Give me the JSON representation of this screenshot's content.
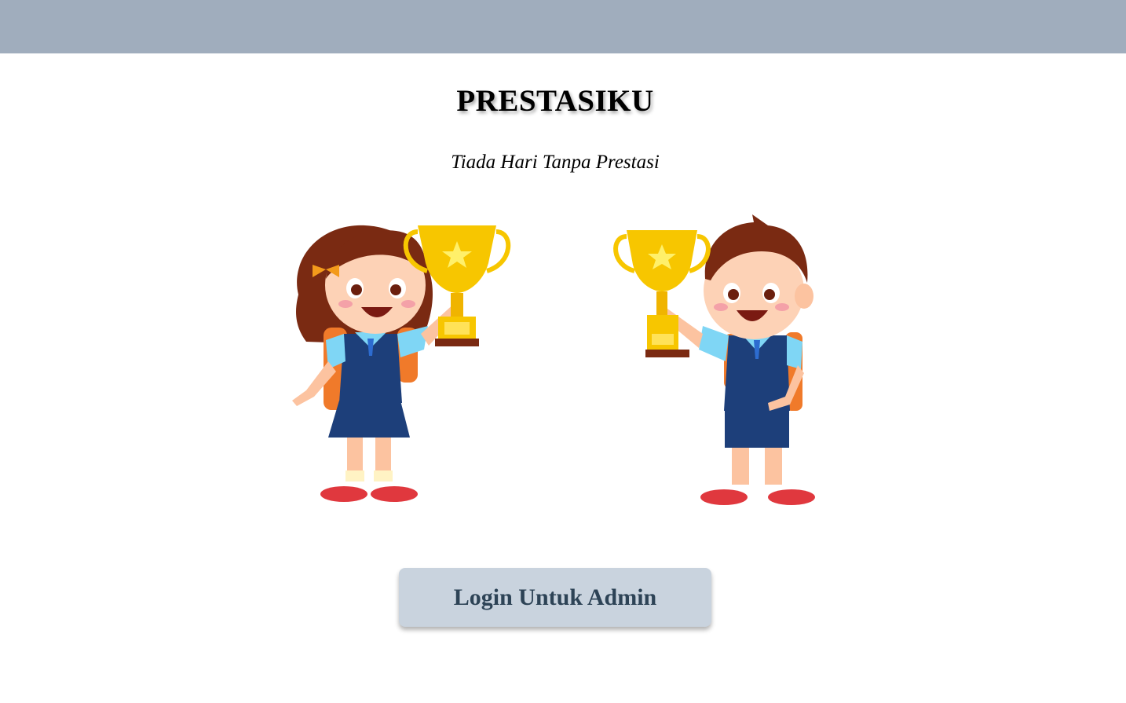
{
  "header": {
    "bar_color": "#a0adbd"
  },
  "main": {
    "title": "PRESTASIKU",
    "tagline": "Tiada Hari Tanpa Prestasi",
    "illustration": {
      "description_icon": "kids-with-trophies-illustration"
    },
    "login_button_label": "Login Untuk Admin"
  },
  "colors": {
    "button_bg": "#c9d3de",
    "button_text": "#2d4356",
    "trophy_gold": "#f7c600",
    "uniform_navy": "#1d3f7a",
    "shirt_blue": "#7fd6f5",
    "backpack_orange": "#f07a2a",
    "hair_brown": "#7a2a12",
    "shoe_red": "#e0383e"
  }
}
